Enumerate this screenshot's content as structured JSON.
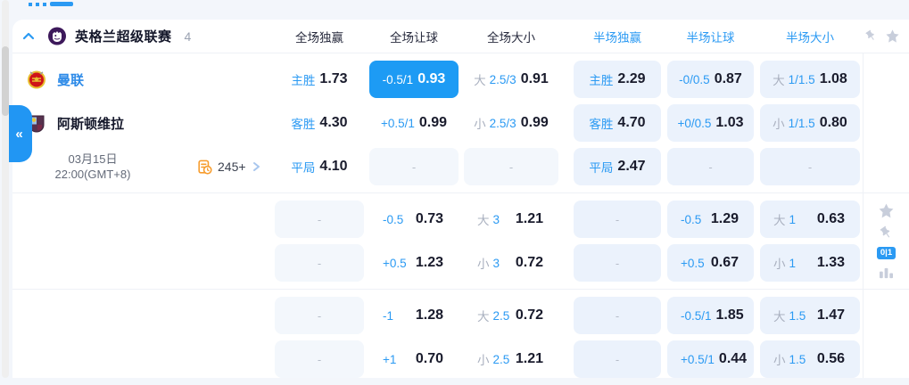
{
  "colors": {
    "accent": "#2196f3",
    "selected_cell": "#1d9bf4",
    "markets_icon": "#f79c2d",
    "half_tint": "#ebf2fc"
  },
  "league": {
    "name": "英格兰超级联赛",
    "count": "4",
    "columns": [
      {
        "label": "全场独赢",
        "half": false
      },
      {
        "label": "全场让球",
        "half": false
      },
      {
        "label": "全场大小",
        "half": false
      },
      {
        "label": "半场独赢",
        "half": true
      },
      {
        "label": "半场让球",
        "half": true
      },
      {
        "label": "半场大小",
        "half": true
      }
    ]
  },
  "match": {
    "home": {
      "name": "曼联"
    },
    "away": {
      "name": "阿斯顿维拉"
    },
    "info": {
      "date": "03月15日",
      "time": "22:00(GMT+8)",
      "markets_count": "245+"
    }
  },
  "side": {
    "badge": "0|1"
  },
  "groups": [
    {
      "rows": [
        {
          "cells": [
            {
              "label": "主胜",
              "value": "1.73"
            },
            {
              "label": "-0.5/1",
              "value": "0.93",
              "selected": true
            },
            {
              "pre": "大",
              "label": "2.5/3",
              "value": "0.91"
            },
            {
              "label": "主胜",
              "value": "2.29",
              "half": true
            },
            {
              "label": "-0/0.5",
              "value": "0.87",
              "half": true
            },
            {
              "pre": "大",
              "label": "1/1.5",
              "value": "1.08",
              "half": true
            }
          ]
        },
        {
          "cells": [
            {
              "label": "客胜",
              "value": "4.30"
            },
            {
              "label": "+0.5/1",
              "value": "0.99"
            },
            {
              "pre": "小",
              "label": "2.5/3",
              "value": "0.99"
            },
            {
              "label": "客胜",
              "value": "4.70",
              "half": true
            },
            {
              "label": "+0/0.5",
              "value": "1.03",
              "half": true
            },
            {
              "pre": "小",
              "label": "1/1.5",
              "value": "0.80",
              "half": true
            }
          ]
        },
        {
          "cells": [
            {
              "label": "平局",
              "value": "4.10"
            },
            {
              "empty": true
            },
            {
              "empty": true
            },
            {
              "label": "平局",
              "value": "2.47",
              "half": true
            },
            {
              "empty": true,
              "half": true
            },
            {
              "empty": true,
              "half": true
            }
          ]
        }
      ]
    },
    {
      "rows": [
        {
          "cells": [
            {
              "empty": true
            },
            {
              "label": "-0.5",
              "value": "0.73",
              "split": true
            },
            {
              "pre": "大",
              "label": "3",
              "value": "1.21",
              "split": true
            },
            {
              "empty": true,
              "half": true
            },
            {
              "label": "-0.5",
              "value": "1.29",
              "half": true,
              "split": true
            },
            {
              "pre": "大",
              "label": "1",
              "value": "0.63",
              "half": true,
              "split": true
            }
          ]
        },
        {
          "cells": [
            {
              "empty": true
            },
            {
              "label": "+0.5",
              "value": "1.23",
              "split": true
            },
            {
              "pre": "小",
              "label": "3",
              "value": "0.72",
              "split": true
            },
            {
              "empty": true,
              "half": true
            },
            {
              "label": "+0.5",
              "value": "0.67",
              "half": true,
              "split": true
            },
            {
              "pre": "小",
              "label": "1",
              "value": "1.33",
              "half": true,
              "split": true
            }
          ]
        }
      ]
    },
    {
      "rows": [
        {
          "cells": [
            {
              "empty": true
            },
            {
              "label": "-1",
              "value": "1.28",
              "split": true
            },
            {
              "pre": "大",
              "label": "2.5",
              "value": "0.72",
              "split": true
            },
            {
              "empty": true,
              "half": true
            },
            {
              "label": "-0.5/1",
              "value": "1.85",
              "half": true,
              "split": true
            },
            {
              "pre": "大",
              "label": "1.5",
              "value": "1.47",
              "half": true,
              "split": true
            }
          ]
        },
        {
          "cells": [
            {
              "empty": true
            },
            {
              "label": "+1",
              "value": "0.70",
              "split": true
            },
            {
              "pre": "小",
              "label": "2.5",
              "value": "1.21",
              "split": true
            },
            {
              "empty": true,
              "half": true
            },
            {
              "label": "+0.5/1",
              "value": "0.44",
              "half": true,
              "split": true
            },
            {
              "pre": "小",
              "label": "1.5",
              "value": "0.56",
              "half": true,
              "split": true
            }
          ]
        }
      ]
    }
  ]
}
